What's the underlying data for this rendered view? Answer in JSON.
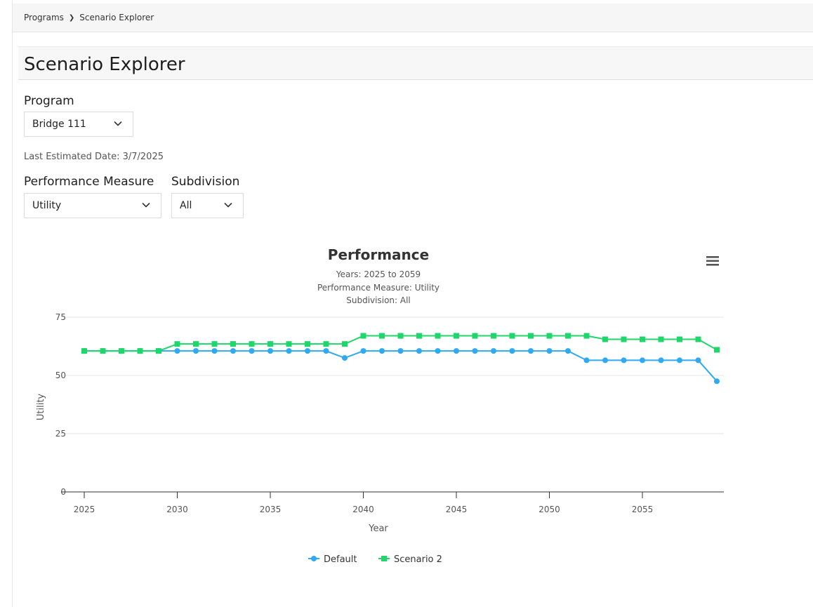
{
  "breadcrumb": {
    "items": [
      "Programs",
      "Scenario Explorer"
    ],
    "separator": "❯"
  },
  "page": {
    "title": "Scenario Explorer"
  },
  "program": {
    "label": "Program",
    "selected": "Bridge 111"
  },
  "last_estimated": "Last Estimated Date: 3/7/2025",
  "performance_measure": {
    "label": "Performance Measure",
    "selected": "Utility"
  },
  "subdivision": {
    "label": "Subdivision",
    "selected": "All"
  },
  "chart_menu_icon": "hamburger-menu-icon",
  "chart_data": {
    "type": "line",
    "title": "Performance",
    "subtitle": [
      "Years: 2025 to 2059",
      "Performance Measure: Utility",
      "Subdivision: All"
    ],
    "xlabel": "Year",
    "ylabel": "Utility",
    "xlim": [
      2025,
      2059
    ],
    "ylim": [
      0,
      75
    ],
    "x_ticks": [
      2025,
      2030,
      2035,
      2040,
      2045,
      2050,
      2055
    ],
    "y_ticks": [
      0,
      25,
      50,
      75
    ],
    "grid": true,
    "legend_position": "bottom-center",
    "x": [
      2025,
      2026,
      2027,
      2028,
      2029,
      2030,
      2031,
      2032,
      2033,
      2034,
      2035,
      2036,
      2037,
      2038,
      2039,
      2040,
      2041,
      2042,
      2043,
      2044,
      2045,
      2046,
      2047,
      2048,
      2049,
      2050,
      2051,
      2052,
      2053,
      2054,
      2055,
      2056,
      2057,
      2058,
      2059
    ],
    "series": [
      {
        "name": "Default",
        "color": "#2fa9f2",
        "marker": "circle",
        "values": [
          60.5,
          60.5,
          60.5,
          60.5,
          60.5,
          60.5,
          60.5,
          60.5,
          60.5,
          60.5,
          60.5,
          60.5,
          60.5,
          60.5,
          57.5,
          60.5,
          60.5,
          60.5,
          60.5,
          60.5,
          60.5,
          60.5,
          60.5,
          60.5,
          60.5,
          60.5,
          60.5,
          56.5,
          56.5,
          56.5,
          56.5,
          56.5,
          56.5,
          56.5,
          47.5
        ]
      },
      {
        "name": "Scenario 2",
        "color": "#1fd66b",
        "marker": "square",
        "values": [
          60.5,
          60.5,
          60.5,
          60.5,
          60.5,
          63.5,
          63.5,
          63.5,
          63.5,
          63.5,
          63.5,
          63.5,
          63.5,
          63.5,
          63.5,
          67,
          67,
          67,
          67,
          67,
          67,
          67,
          67,
          67,
          67,
          67,
          67,
          67,
          65.5,
          65.5,
          65.5,
          65.5,
          65.5,
          65.5,
          61
        ]
      }
    ]
  }
}
